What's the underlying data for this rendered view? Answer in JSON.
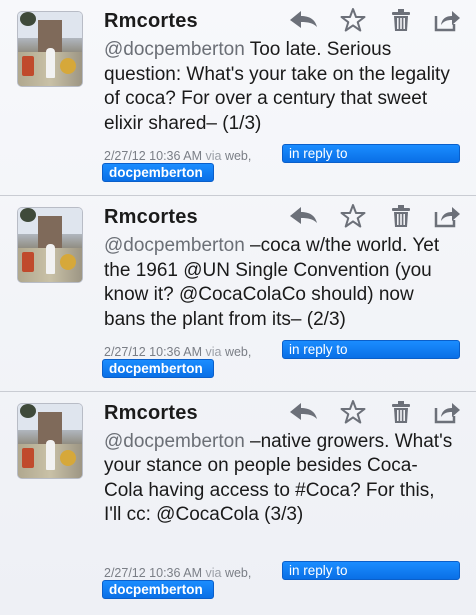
{
  "tweets": [
    {
      "username": "Rmcortes",
      "mention": "@docpemberton",
      "body": " Too late. Serious question: What's your take on the legality of coca? For over a century that sweet elixir shared– (1/3)",
      "timestamp": "2/27/12 10:36 AM",
      "via_label": "via",
      "source": "web,",
      "reply_label": "in reply to",
      "reply_user": "docpemberton"
    },
    {
      "username": "Rmcortes",
      "mention": "@docpemberton",
      "body": " –coca w/the world. Yet the 1961 @UN Single Convention (you know it? @CocaColaCo should) now bans the plant from its– (2/3)",
      "timestamp": "2/27/12 10:36 AM",
      "via_label": "via",
      "source": "web,",
      "reply_label": "in reply to",
      "reply_user": "docpemberton"
    },
    {
      "username": "Rmcortes",
      "mention": "@docpemberton",
      "body": " –native growers. What's your stance on people besides Coca-Cola having access to #Coca? For this, I'll cc: @CocaCola (3/3)",
      "timestamp": "2/27/12 10:36 AM",
      "via_label": "via",
      "source": "web,",
      "reply_label": "in reply to",
      "reply_user": "docpemberton"
    }
  ],
  "icons": [
    "reply-icon",
    "favorite-star-icon",
    "delete-trash-icon",
    "share-icon"
  ],
  "colors": {
    "tag_blue": "#0a6fe6",
    "mention_gray": "#6b6f76",
    "background": "#f4f5f9"
  }
}
